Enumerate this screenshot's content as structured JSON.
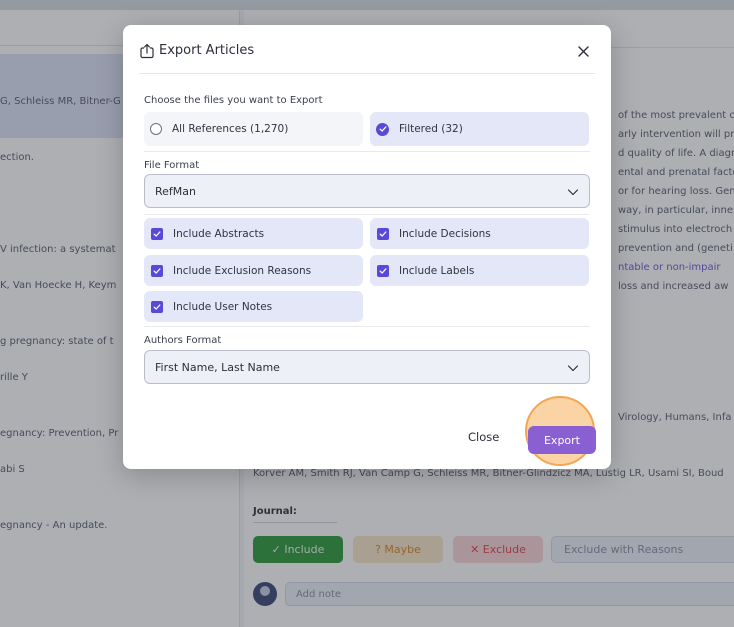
{
  "background": {
    "left_lines": [
      "G, Schleiss MR, Bitner-G",
      "ection.",
      "V infection: a",
      "systemat",
      "K, Van Hoecke H, Keym",
      "g pregnancy: state of t",
      "rille Y",
      "egnancy: Prevention, Pr",
      "abi S",
      "egnancy - An update."
    ],
    "right_lines": [
      "of the most prevalent c",
      "arly intervention will pre",
      "d quality of life. A diagno",
      "ental and prenatal facto",
      "or for hearing loss. Gene",
      "way, in particular, inner",
      "stimulus into electroch",
      "prevention and (geneti",
      "ntable or non-impair",
      "loss and increased aw",
      "Virology, Humans, Infa",
      "Korver AM, Smith RJ, Van Camp G, Schleiss MR, Bitner-Glindzicz MA, Lustig LR, Usami SI, Boud"
    ],
    "journal_label": "Journal:",
    "decision_buttons": {
      "include": "✓ Include",
      "maybe": "? Maybe",
      "exclude": "✕ Exclude",
      "exclude_reasons": "Exclude with Reasons"
    },
    "note_placeholder": "Add note"
  },
  "modal": {
    "title": "Export Articles",
    "files_label": "Choose the files you want to Export",
    "file_options": [
      {
        "label": "All References (1,270)",
        "selected": false
      },
      {
        "label": "Filtered (32)",
        "selected": true
      }
    ],
    "file_format_label": "File Format",
    "file_format_value": "RefMan",
    "include_options": [
      {
        "label": "Include Abstracts",
        "checked": true
      },
      {
        "label": "Include Decisions",
        "checked": true
      },
      {
        "label": "Include Exclusion Reasons",
        "checked": true
      },
      {
        "label": "Include Labels",
        "checked": true
      },
      {
        "label": "Include User Notes",
        "checked": true
      }
    ],
    "authors_format_label": "Authors Format",
    "authors_format_value": "First Name, Last Name",
    "close_label": "Close",
    "export_label": "Export"
  },
  "colors": {
    "accent": "#5a48d8",
    "export_button": "#6c4fd8",
    "click_highlight": "#f2a655"
  }
}
